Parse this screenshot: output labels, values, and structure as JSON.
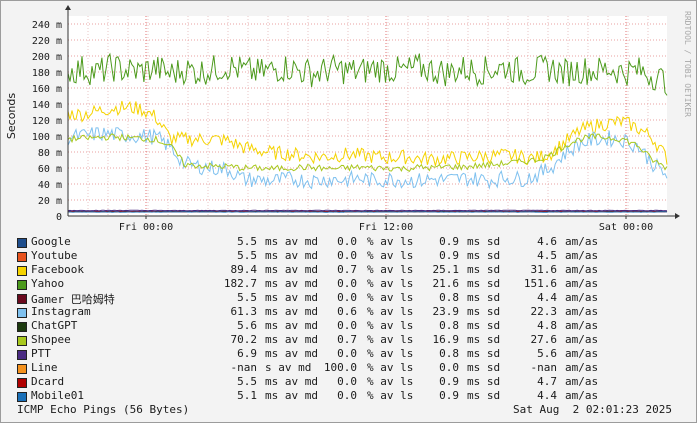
{
  "chart_data": {
    "type": "line",
    "ylabel": "Seconds",
    "ylim": [
      0,
      0.25
    ],
    "y_ticks": [
      "0",
      "20 m",
      "40 m",
      "60 m",
      "80 m",
      "100 m",
      "120 m",
      "140 m",
      "160 m",
      "180 m",
      "200 m",
      "220 m",
      "240 m"
    ],
    "x_ticks": [
      "Fri 00:00",
      "Fri 12:00",
      "Sat 00:00"
    ],
    "watermark": "RRDTOOL / TOBI OETIKER",
    "series": [
      {
        "name": "Google",
        "color": "#1f4e8c",
        "median": "5.5",
        "median_unit": "ms av md",
        "loss": "0.0",
        "loss_unit": "% av ls",
        "sd": "0.9",
        "sd_unit": "ms sd",
        "amas": "4.6",
        "amas_unit": "am/as",
        "values": [
          5.6,
          5.5,
          5.4,
          5.6,
          5.5,
          5.5,
          5.7,
          5.4,
          5.5,
          5.6,
          5.5,
          5.5
        ]
      },
      {
        "name": "Youtube",
        "color": "#e8531e",
        "median": "5.5",
        "median_unit": "ms av md",
        "loss": "0.0",
        "loss_unit": "% av ls",
        "sd": "0.9",
        "sd_unit": "ms sd",
        "amas": "4.5",
        "amas_unit": "am/as",
        "values": [
          5.5,
          5.4,
          5.5,
          5.6,
          5.5,
          5.4,
          5.6,
          5.5,
          5.5,
          5.4,
          5.5,
          5.5
        ]
      },
      {
        "name": "Facebook",
        "color": "#f5d300",
        "median": "89.4",
        "median_unit": "ms av md",
        "loss": "0.7",
        "loss_unit": "% av ls",
        "sd": "25.1",
        "sd_unit": "ms sd",
        "amas": "31.6",
        "amas_unit": "am/as",
        "values": [
          128,
          127,
          131,
          135,
          136,
          134,
          124,
          97,
          96,
          96,
          96,
          94,
          86,
          82,
          79,
          78,
          76,
          74,
          75,
          77,
          76,
          74,
          73,
          74,
          72,
          71,
          72,
          73,
          74,
          75,
          76,
          74,
          72,
          78,
          92,
          106,
          113,
          116,
          118,
          110,
          98,
          72
        ]
      },
      {
        "name": "Yahoo",
        "color": "#4c9a1c",
        "median": "182.7",
        "median_unit": "ms av md",
        "loss": "0.0",
        "loss_unit": "% av ls",
        "sd": "21.6",
        "sd_unit": "ms sd",
        "amas": "151.6",
        "amas_unit": "am/as",
        "values": [
          180,
          184,
          179,
          186,
          182,
          181,
          185,
          178,
          183,
          180,
          184,
          187,
          182,
          179,
          183,
          186,
          181,
          178,
          184,
          182,
          180,
          185,
          183,
          181,
          186,
          182,
          179,
          184,
          181,
          183,
          186,
          180,
          182,
          185,
          179,
          183,
          181,
          184,
          180,
          182,
          176,
          168
        ]
      },
      {
        "name": "Gamer 巴哈姆特",
        "color": "#6b0a1e",
        "median": "5.5",
        "median_unit": "ms av md",
        "loss": "0.0",
        "loss_unit": "% av ls",
        "sd": "0.8",
        "sd_unit": "ms sd",
        "amas": "4.4",
        "amas_unit": "am/as",
        "values": [
          5.5,
          5.4,
          5.5,
          5.6,
          5.5,
          5.5,
          5.4,
          5.5,
          5.6,
          5.5,
          5.5,
          5.5
        ]
      },
      {
        "name": "Instagram",
        "color": "#7fc1ef",
        "median": "61.3",
        "median_unit": "ms av md",
        "loss": "0.6",
        "loss_unit": "% av ls",
        "sd": "23.9",
        "sd_unit": "ms sd",
        "amas": "22.3",
        "amas_unit": "am/as",
        "values": [
          98,
          100,
          103,
          102,
          101,
          100,
          99,
          86,
          65,
          62,
          60,
          58,
          46,
          45,
          44,
          46,
          45,
          44,
          46,
          45,
          47,
          44,
          46,
          45,
          44,
          46,
          45,
          47,
          46,
          45,
          48,
          46,
          50,
          60,
          78,
          90,
          96,
          97,
          95,
          88,
          66,
          50
        ]
      },
      {
        "name": "ChatGPT",
        "color": "#1c3a0e",
        "median": "5.6",
        "median_unit": "ms av md",
        "loss": "0.0",
        "loss_unit": "% av ls",
        "sd": "0.8",
        "sd_unit": "ms sd",
        "amas": "4.8",
        "amas_unit": "am/as",
        "values": [
          5.6,
          5.5,
          5.6,
          5.7,
          5.6,
          5.5,
          5.6,
          5.6,
          5.7,
          5.5,
          5.6,
          5.6
        ]
      },
      {
        "name": "Shopee",
        "color": "#a8c81e",
        "median": "70.2",
        "median_unit": "ms av md",
        "loss": "0.7",
        "loss_unit": "% av ls",
        "sd": "16.9",
        "sd_unit": "ms sd",
        "amas": "27.6",
        "amas_unit": "am/as",
        "values": [
          96,
          97,
          98,
          99,
          98,
          97,
          96,
          88,
          64,
          63,
          62,
          62,
          60,
          60,
          59,
          60,
          61,
          60,
          59,
          60,
          61,
          60,
          60,
          59,
          61,
          60,
          62,
          61,
          63,
          64,
          66,
          68,
          70,
          76,
          88,
          96,
          99,
          98,
          96,
          88,
          70,
          60
        ]
      },
      {
        "name": "PTT",
        "color": "#4a2a82",
        "median": "6.9",
        "median_unit": "ms av md",
        "loss": "0.0",
        "loss_unit": "% av ls",
        "sd": "0.8",
        "sd_unit": "ms sd",
        "amas": "5.6",
        "amas_unit": "am/as",
        "values": [
          6.9,
          7.0,
          6.8,
          6.9,
          7.0,
          6.9,
          6.8,
          6.9,
          7.0,
          6.9,
          6.9,
          6.8
        ]
      },
      {
        "name": "Line",
        "color": "#f5921e",
        "median": "-nan",
        "median_unit": "s av md",
        "loss": "100.0",
        "loss_unit": "% av ls",
        "sd": "0.0",
        "sd_unit": "ms sd",
        "amas": "-nan",
        "amas_unit": "am/as",
        "values": []
      },
      {
        "name": "Dcard",
        "color": "#b00000",
        "median": "5.5",
        "median_unit": "ms av md",
        "loss": "0.0",
        "loss_unit": "% av ls",
        "sd": "0.9",
        "sd_unit": "ms sd",
        "amas": "4.7",
        "amas_unit": "am/as",
        "values": [
          5.5,
          5.6,
          5.4,
          5.5,
          5.6,
          5.5,
          5.5,
          5.4,
          5.6,
          5.5,
          5.5,
          5.5
        ]
      },
      {
        "name": "Mobile01",
        "color": "#1a70b8",
        "median": "5.1",
        "median_unit": "ms av md",
        "loss": "0.0",
        "loss_unit": "% av ls",
        "sd": "0.9",
        "sd_unit": "ms sd",
        "amas": "4.4",
        "amas_unit": "am/as",
        "values": [
          5.1,
          5.0,
          5.2,
          5.1,
          5.1,
          5.0,
          5.2,
          5.1,
          5.1,
          5.0,
          5.1,
          5.1
        ]
      }
    ]
  },
  "footer": {
    "title": "ICMP Echo Pings (56 Bytes)",
    "timestamp": "Sat Aug  2 02:01:23 2025"
  }
}
